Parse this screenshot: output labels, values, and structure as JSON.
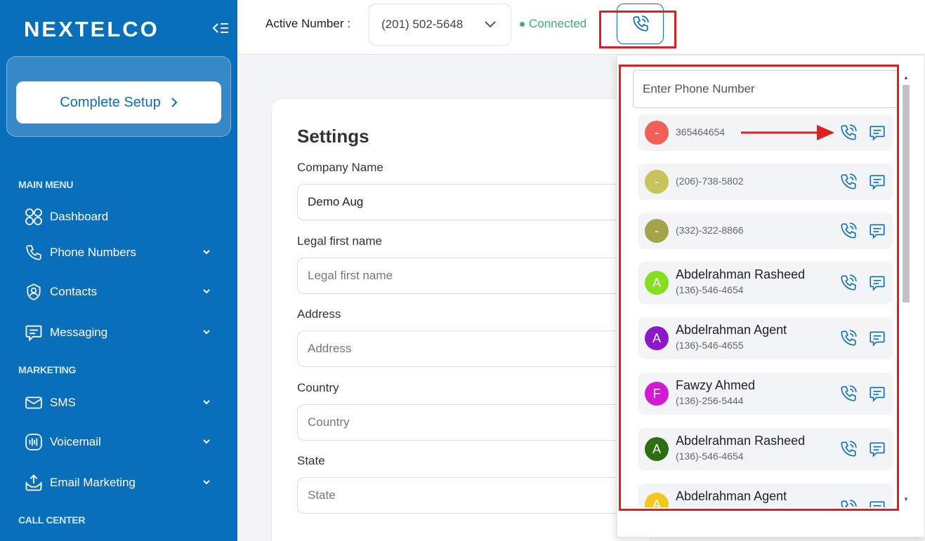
{
  "app": {
    "logo": "NEXTELCO"
  },
  "sidebar": {
    "setup_label": "Complete Setup",
    "section_main": "MAIN MENU",
    "section_marketing": "MARKETING",
    "section_callcenter": "CALL CENTER",
    "items": [
      {
        "label": "Dashboard",
        "icon": "dashboard-icon"
      },
      {
        "label": "Phone Numbers",
        "icon": "phone-icon"
      },
      {
        "label": "Contacts",
        "icon": "contact-icon"
      },
      {
        "label": "Messaging",
        "icon": "message-icon"
      },
      {
        "label": "SMS",
        "icon": "sms-icon"
      },
      {
        "label": "Voicemail",
        "icon": "voicemail-icon"
      },
      {
        "label": "Email Marketing",
        "icon": "email-icon"
      }
    ]
  },
  "topbar": {
    "active_label": "Active Number :",
    "active_number": "(201) 502-5648",
    "status": "Connected"
  },
  "settings": {
    "title": "Settings",
    "fields": [
      {
        "label": "Company Name",
        "value": "Demo Aug",
        "placeholder": ""
      },
      {
        "label": "Legal first name",
        "value": "",
        "placeholder": "Legal first name"
      },
      {
        "label": "Address",
        "value": "",
        "placeholder": "Address"
      },
      {
        "label": "Country",
        "value": "",
        "placeholder": "Country"
      },
      {
        "label": "State",
        "value": "",
        "placeholder": "State"
      }
    ]
  },
  "dialer": {
    "placeholder": "Enter Phone Number",
    "contacts": [
      {
        "initial": "-",
        "name": "",
        "number": "365464654",
        "color": "#f2605a"
      },
      {
        "initial": "-",
        "name": "",
        "number": "(206)-738-5802",
        "color": "#c8c35a"
      },
      {
        "initial": "-",
        "name": "",
        "number": "(332)-322-8866",
        "color": "#a3a34a"
      },
      {
        "initial": "A",
        "name": "Abdelrahman Rasheed",
        "number": "(136)-546-4654",
        "color": "#84e01f"
      },
      {
        "initial": "A",
        "name": "Abdelrahman Agent",
        "number": "(136)-546-4655",
        "color": "#8e17c9"
      },
      {
        "initial": "F",
        "name": "Fawzy Ahmed",
        "number": "(136)-256-5444",
        "color": "#d11bd1"
      },
      {
        "initial": "A",
        "name": "Abdelrahman Rasheed",
        "number": "(136)-546-4654",
        "color": "#2e6d10"
      },
      {
        "initial": "A",
        "name": "Abdelrahman Agent",
        "number": "",
        "color": "#f0c81e"
      }
    ]
  },
  "colors": {
    "brand": "#0a6fba",
    "connected": "#3bb273",
    "annotation": "#e02020"
  }
}
